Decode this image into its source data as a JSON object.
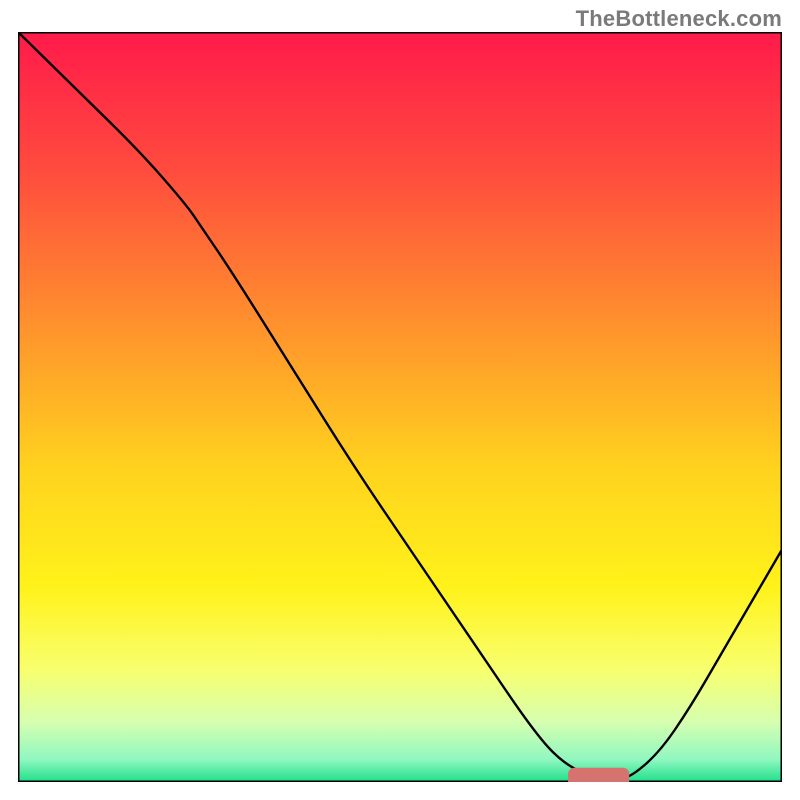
{
  "watermark": "TheBottleneck.com",
  "chart_data": {
    "type": "line",
    "title": "",
    "xlabel": "",
    "ylabel": "",
    "xlim": [
      0,
      100
    ],
    "ylim": [
      0,
      100
    ],
    "grid": false,
    "legend": false,
    "background_gradient": {
      "stops": [
        {
          "offset": 0.0,
          "color": "#ff1a4a"
        },
        {
          "offset": 0.18,
          "color": "#ff4a3e"
        },
        {
          "offset": 0.38,
          "color": "#ff8e2e"
        },
        {
          "offset": 0.58,
          "color": "#ffd21e"
        },
        {
          "offset": 0.74,
          "color": "#fff21a"
        },
        {
          "offset": 0.85,
          "color": "#f8ff6e"
        },
        {
          "offset": 0.92,
          "color": "#d6ffb0"
        },
        {
          "offset": 0.97,
          "color": "#90f7c0"
        },
        {
          "offset": 1.0,
          "color": "#1ee08a"
        }
      ]
    },
    "series": [
      {
        "name": "curve",
        "color": "#000000",
        "width": 2.4,
        "x": [
          0,
          8,
          16,
          22,
          24,
          28,
          36,
          44,
          52,
          60,
          68,
          72,
          76,
          78,
          80,
          84,
          88,
          92,
          96,
          100
        ],
        "y": [
          100,
          92,
          84,
          77,
          74,
          68,
          55,
          42,
          30,
          18,
          6,
          2,
          0.5,
          0.5,
          0.5,
          4,
          10,
          17,
          24,
          31
        ]
      }
    ],
    "marker": {
      "name": "optimum",
      "color": "#d6736f",
      "x_start": 72,
      "x_end": 80,
      "y": 0.5,
      "thickness": 2.8
    }
  }
}
